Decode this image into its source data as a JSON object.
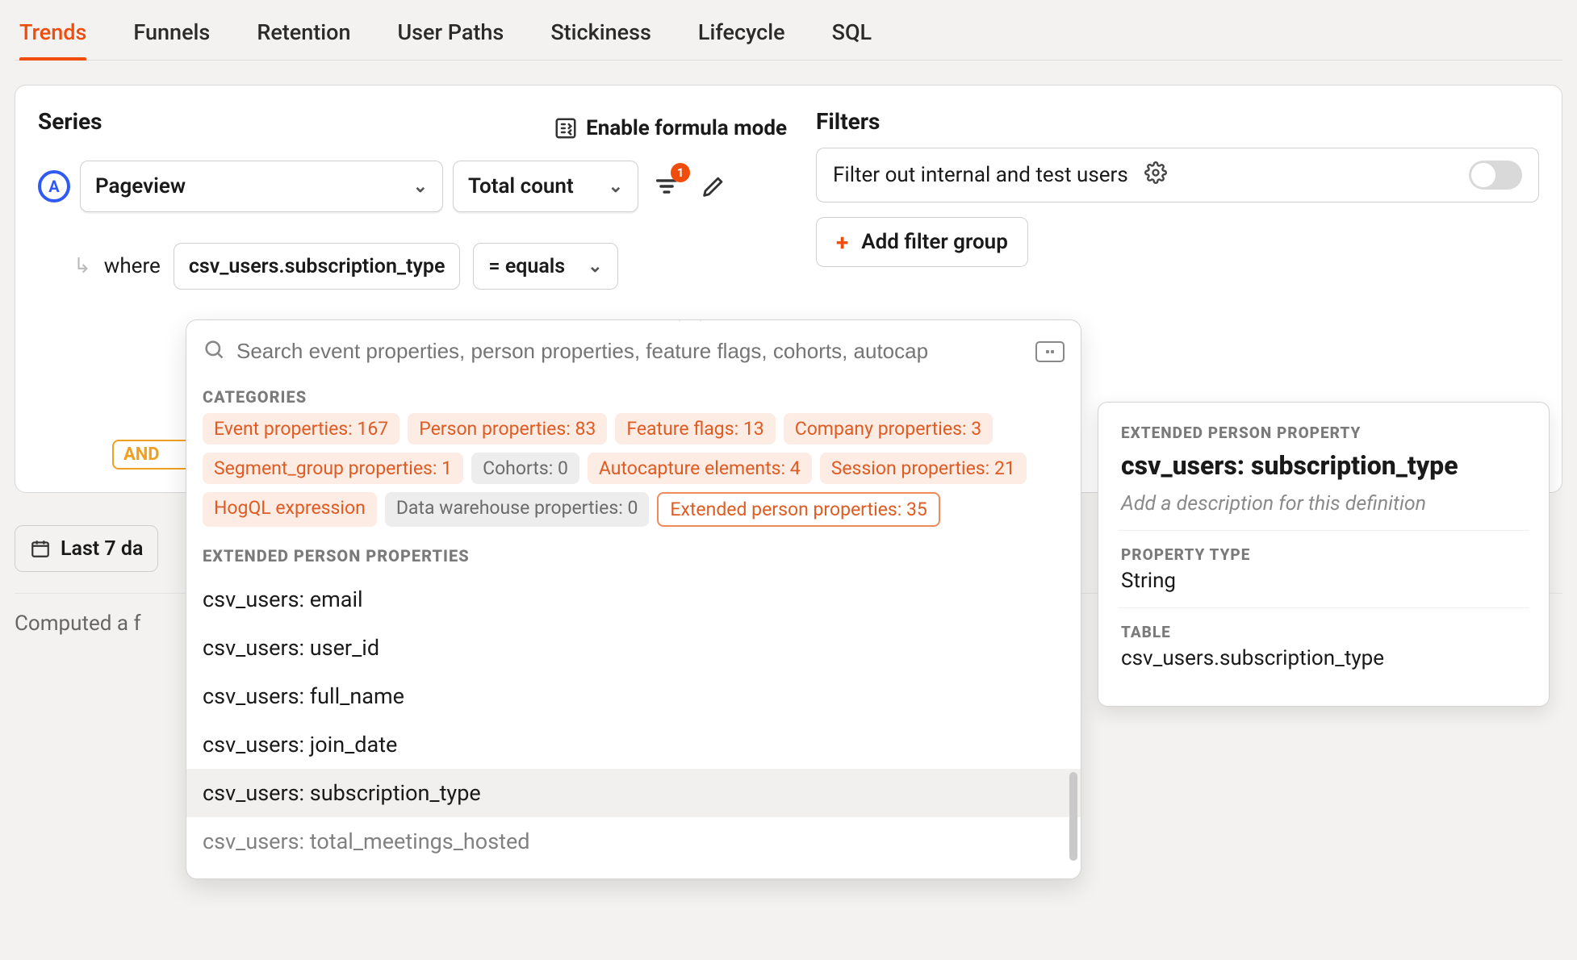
{
  "tabs": [
    "Trends",
    "Funnels",
    "Retention",
    "User Paths",
    "Stickiness",
    "Lifecycle",
    "SQL"
  ],
  "activeTab": "Trends",
  "series": {
    "heading": "Series",
    "letter": "A",
    "event": "Pageview",
    "metric": "Total count",
    "filterBadge": "1",
    "formulaLabel": "Enable formula mode",
    "whereLabel": "where",
    "whereProperty": "csv_users.subscription_type",
    "whereOperator": "= equals",
    "andLabel": "AND"
  },
  "filters": {
    "heading": "Filters",
    "internalLabel": "Filter out internal and test users",
    "addGroupLabel": "Add filter group"
  },
  "dropdown": {
    "placeholder": "Search event properties, person properties, feature flags, cohorts, autocap",
    "categoriesLabel": "CATEGORIES",
    "chips": [
      {
        "label": "Event properties: 167",
        "style": "orange"
      },
      {
        "label": "Person properties: 83",
        "style": "orange"
      },
      {
        "label": "Feature flags: 13",
        "style": "orange"
      },
      {
        "label": "Company properties: 3",
        "style": "orange"
      },
      {
        "label": "Segment_group properties: 1",
        "style": "orange"
      },
      {
        "label": "Cohorts: 0",
        "style": "gray"
      },
      {
        "label": "Autocapture elements: 4",
        "style": "orange"
      },
      {
        "label": "Session properties: 21",
        "style": "orange"
      },
      {
        "label": "HogQL expression",
        "style": "orange"
      },
      {
        "label": "Data warehouse properties: 0",
        "style": "gray"
      },
      {
        "label": "Extended person properties: 35",
        "style": "outline"
      }
    ],
    "sectionLabel": "EXTENDED PERSON PROPERTIES",
    "items": [
      "csv_users: email",
      "csv_users: user_id",
      "csv_users: full_name",
      "csv_users: join_date",
      "csv_users: subscription_type",
      "csv_users: total_meetings_hosted"
    ],
    "selectedIndex": 4
  },
  "detail": {
    "eyebrow": "EXTENDED PERSON PROPERTY",
    "title": "csv_users: subscription_type",
    "descPlaceholder": "Add a description for this definition",
    "propTypeLabel": "PROPERTY TYPE",
    "propType": "String",
    "tableLabel": "TABLE",
    "table": "csv_users.subscription_type"
  },
  "dateRange": "Last 7 da",
  "computedText": "Computed a f"
}
